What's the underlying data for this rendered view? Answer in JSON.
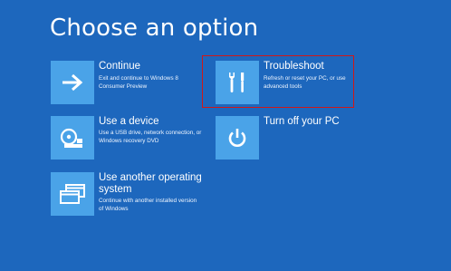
{
  "page": {
    "title": "Choose an option"
  },
  "options": [
    {
      "title": "Continue",
      "description": "Exit and continue to Windows 8 Consumer Preview",
      "icon": "arrow-right-icon"
    },
    {
      "title": "Use a device",
      "description": "Use a USB drive, network connection, or Windows recovery DVD",
      "icon": "disc-drive-icon"
    },
    {
      "title": "Use another operating system",
      "description": "Continue with another installed version of Windows",
      "icon": "windows-stack-icon"
    },
    {
      "title": "Troubleshoot",
      "description": "Refresh or reset your PC, or use advanced tools",
      "icon": "tools-icon"
    },
    {
      "title": "Turn off your PC",
      "description": "",
      "icon": "power-icon"
    }
  ],
  "colors": {
    "background": "#1d67bd",
    "tile": "#4aa3e8",
    "highlight": "#d01818",
    "text": "#ffffff"
  }
}
